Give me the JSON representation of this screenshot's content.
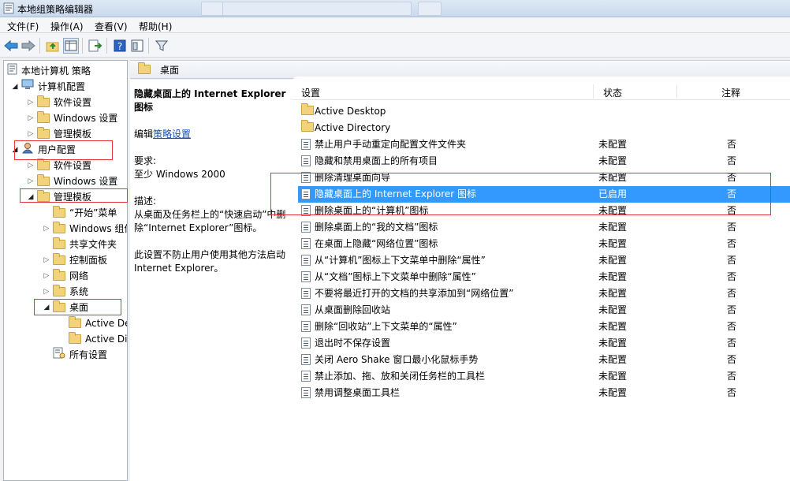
{
  "window": {
    "title": "本地组策略编辑器"
  },
  "menu": [
    "文件(F)",
    "操作(A)",
    "查看(V)",
    "帮助(H)"
  ],
  "tree": {
    "items": [
      {
        "label": "本地计算机 策略",
        "level": 0,
        "expander": "",
        "icon": "policy-document-icon"
      },
      {
        "label": "计算机配置",
        "level": 1,
        "expander": "open",
        "icon": "computer-icon"
      },
      {
        "label": "软件设置",
        "level": 2,
        "expander": "closed",
        "icon": "folder-icon"
      },
      {
        "label": "Windows 设置",
        "level": 2,
        "expander": "closed",
        "icon": "folder-icon"
      },
      {
        "label": "管理模板",
        "level": 2,
        "expander": "closed",
        "icon": "folder-icon"
      },
      {
        "label": "用户配置",
        "level": 1,
        "expander": "open",
        "icon": "user-icon"
      },
      {
        "label": "软件设置",
        "level": 2,
        "expander": "closed",
        "icon": "folder-icon"
      },
      {
        "label": "Windows 设置",
        "level": 2,
        "expander": "closed",
        "icon": "folder-icon"
      },
      {
        "label": "管理模板",
        "level": 2,
        "expander": "open",
        "icon": "folder-icon"
      },
      {
        "label": "“开始”菜单",
        "level": 3,
        "expander": "",
        "icon": "folder-icon"
      },
      {
        "label": "Windows 组件",
        "level": 3,
        "expander": "closed",
        "icon": "folder-icon"
      },
      {
        "label": "共享文件夹",
        "level": 3,
        "expander": "",
        "icon": "folder-icon"
      },
      {
        "label": "控制面板",
        "level": 3,
        "expander": "closed",
        "icon": "folder-icon"
      },
      {
        "label": "网络",
        "level": 3,
        "expander": "closed",
        "icon": "folder-icon"
      },
      {
        "label": "系统",
        "level": 3,
        "expander": "closed",
        "icon": "folder-icon"
      },
      {
        "label": "桌面",
        "level": 3,
        "expander": "open",
        "icon": "folder-icon"
      },
      {
        "label": "Active Desktop",
        "level": 4,
        "expander": "",
        "icon": "folder-icon"
      },
      {
        "label": "Active Directory",
        "level": 4,
        "expander": "",
        "icon": "folder-icon"
      },
      {
        "label": "所有设置",
        "level": 3,
        "expander": "",
        "icon": "all-settings-icon"
      }
    ]
  },
  "content": {
    "header": "桌面",
    "description": {
      "title": "隐藏桌面上的 Internet Explorer 图标",
      "edit_prefix": "编辑",
      "edit_link": "策略设置",
      "requirements_label": "要求:",
      "requirements": "至少 Windows 2000",
      "desc_label": "描述:",
      "desc_text": "从桌面及任务栏上的“快速启动”中删除“Internet Explorer”图标。",
      "note_text": "此设置不防止用户使用其他方法启动 Internet Explorer。"
    },
    "columns": {
      "setting": "设置",
      "state": "状态",
      "comment": "注释"
    },
    "rows": [
      {
        "name": "Active Desktop",
        "state": "",
        "comment": "",
        "icon": "folder-icon",
        "selected": false
      },
      {
        "name": "Active Directory",
        "state": "",
        "comment": "",
        "icon": "folder-icon",
        "selected": false
      },
      {
        "name": "禁止用户手动重定向配置文件文件夹",
        "state": "未配置",
        "comment": "否",
        "icon": "policy-setting-icon",
        "selected": false
      },
      {
        "name": "隐藏和禁用桌面上的所有项目",
        "state": "未配置",
        "comment": "否",
        "icon": "policy-setting-icon",
        "selected": false
      },
      {
        "name": "删除清理桌面向导",
        "state": "未配置",
        "comment": "否",
        "icon": "policy-setting-icon",
        "selected": false
      },
      {
        "name": "隐藏桌面上的 Internet Explorer 图标",
        "state": "已启用",
        "comment": "否",
        "icon": "policy-setting-icon",
        "selected": true
      },
      {
        "name": "删除桌面上的“计算机”图标",
        "state": "未配置",
        "comment": "否",
        "icon": "policy-setting-icon",
        "selected": false
      },
      {
        "name": "删除桌面上的“我的文档”图标",
        "state": "未配置",
        "comment": "否",
        "icon": "policy-setting-icon",
        "selected": false
      },
      {
        "name": "在桌面上隐藏“网络位置”图标",
        "state": "未配置",
        "comment": "否",
        "icon": "policy-setting-icon",
        "selected": false
      },
      {
        "name": "从“计算机”图标上下文菜单中删除“属性”",
        "state": "未配置",
        "comment": "否",
        "icon": "policy-setting-icon",
        "selected": false
      },
      {
        "name": "从“文档”图标上下文菜单中删除“属性”",
        "state": "未配置",
        "comment": "否",
        "icon": "policy-setting-icon",
        "selected": false
      },
      {
        "name": "不要将最近打开的文档的共享添加到“网络位置”",
        "state": "未配置",
        "comment": "否",
        "icon": "policy-setting-icon",
        "selected": false
      },
      {
        "name": "从桌面删除回收站",
        "state": "未配置",
        "comment": "否",
        "icon": "policy-setting-icon",
        "selected": false
      },
      {
        "name": "删除“回收站”上下文菜单的“属性”",
        "state": "未配置",
        "comment": "否",
        "icon": "policy-setting-icon",
        "selected": false
      },
      {
        "name": "退出时不保存设置",
        "state": "未配置",
        "comment": "否",
        "icon": "policy-setting-icon",
        "selected": false
      },
      {
        "name": "关闭 Aero Shake 窗口最小化鼠标手势",
        "state": "未配置",
        "comment": "否",
        "icon": "policy-setting-icon",
        "selected": false
      },
      {
        "name": "禁止添加、拖、放和关闭任务栏的工具栏",
        "state": "未配置",
        "comment": "否",
        "icon": "policy-setting-icon",
        "selected": false
      },
      {
        "name": "禁用调整桌面工具栏",
        "state": "未配置",
        "comment": "否",
        "icon": "policy-setting-icon",
        "selected": false
      }
    ]
  },
  "colors": {
    "selection": "#3399ff",
    "highlight_box": "#e0353e",
    "link": "#1a4fb8"
  }
}
